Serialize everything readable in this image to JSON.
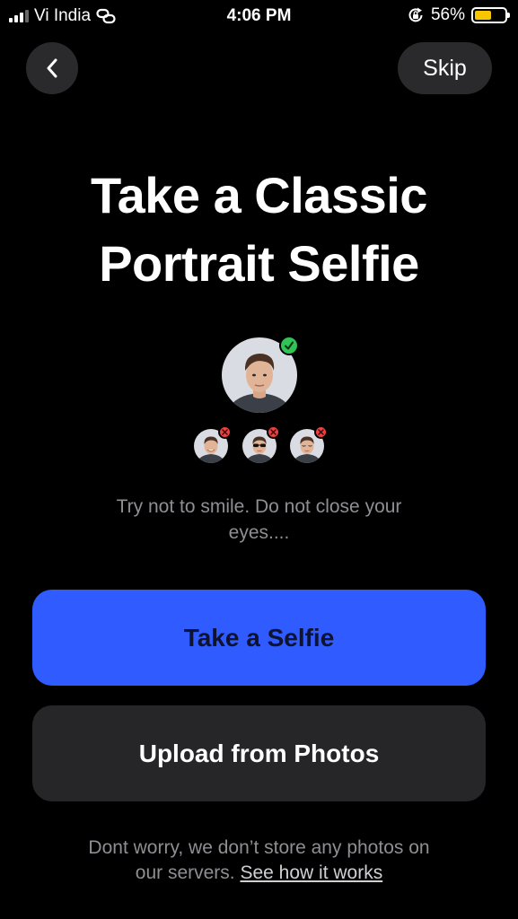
{
  "status_bar": {
    "carrier": "Vi India",
    "time": "4:06 PM",
    "battery_percent": "56%",
    "battery_level": 0.56,
    "icons": [
      "signal-icon",
      "hotspot-icon",
      "orientation-lock-icon",
      "battery-icon"
    ]
  },
  "header": {
    "back_icon": "chevron-left-icon",
    "skip_label": "Skip"
  },
  "title": {
    "line1": "Take a Classic",
    "line2": "Portrait Selfie"
  },
  "examples": {
    "good": {
      "icon": "portrait-face-icon",
      "badge": "checkmark-icon"
    },
    "bad": [
      {
        "icon": "smiling-face-icon",
        "badge": "x-icon"
      },
      {
        "icon": "sunglasses-face-icon",
        "badge": "x-icon"
      },
      {
        "icon": "eyes-closed-face-icon",
        "badge": "x-icon"
      }
    ]
  },
  "hint": "Try not to smile. Do not close your eyes....",
  "buttons": {
    "take_selfie": "Take a Selfie",
    "upload": "Upload from Photos"
  },
  "footer": {
    "text": "Dont worry, we don’t store any photos on our servers.",
    "link": "See how it works"
  },
  "colors": {
    "background": "#000000",
    "primary": "#2F5BFF",
    "secondary_button": "#262629",
    "success": "#2FC454",
    "error": "#EF3F3F",
    "muted_text": "#8E8E93",
    "battery": "#F7C600"
  }
}
